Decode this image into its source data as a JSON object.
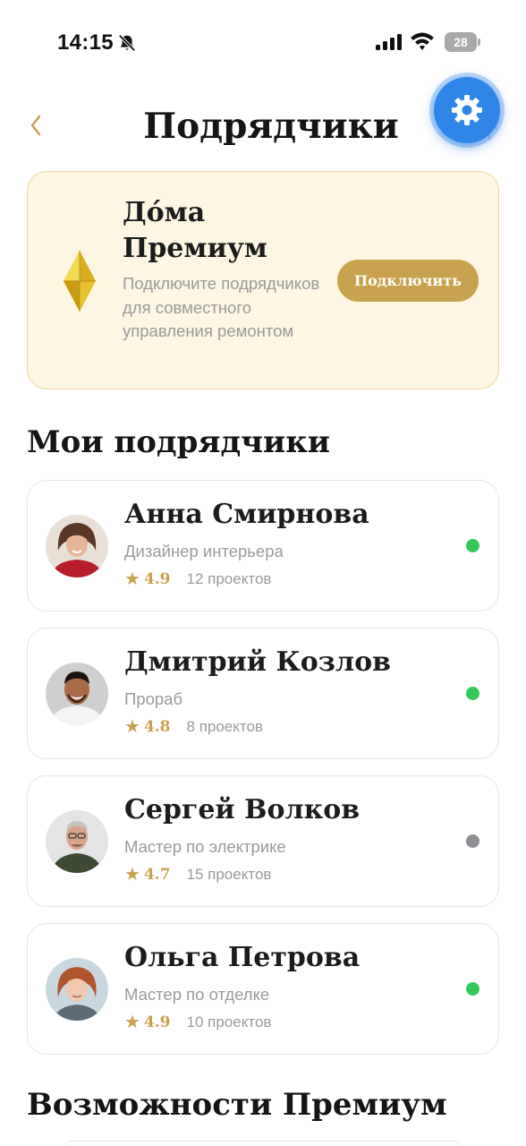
{
  "status_bar": {
    "time": "14:15",
    "battery": "28",
    "icons": [
      "bell-slash-icon",
      "signal-icon",
      "wifi-icon",
      "battery-icon"
    ]
  },
  "header": {
    "back_icon": "chevron-left-icon",
    "title": "Подрядчики",
    "settings_icon": "gear-icon"
  },
  "premium": {
    "icon": "diamond-icon",
    "title": "До́ма Премиум",
    "description": "Подключите подрядчиков для совместного управления ремонтом",
    "button_label": "Подключить"
  },
  "my_contractors": {
    "title": "Мои подрядчики",
    "items": [
      {
        "name": "Анна Смирнова",
        "role": "Дизайнер интерьера",
        "rating": "4.9",
        "projects": "12 проектов",
        "online": true
      },
      {
        "name": "Дмитрий Козлов",
        "role": "Прораб",
        "rating": "4.8",
        "projects": "8 проектов",
        "online": true
      },
      {
        "name": "Сергей Волков",
        "role": "Мастер по электрике",
        "rating": "4.7",
        "projects": "15 проектов",
        "online": false
      },
      {
        "name": "Ольга Петрова",
        "role": "Мастер по отделке",
        "rating": "4.9",
        "projects": "10 проектов",
        "online": true
      }
    ]
  },
  "premium_features": {
    "title": "Возможности Премиум"
  },
  "colors": {
    "accent_gold": "#c9a24f",
    "premium_bg": "#fdf6e3",
    "premium_border": "#ecd89c",
    "online": "#34c759",
    "offline": "#8e8e93",
    "fab_blue": "#2f86e8"
  }
}
